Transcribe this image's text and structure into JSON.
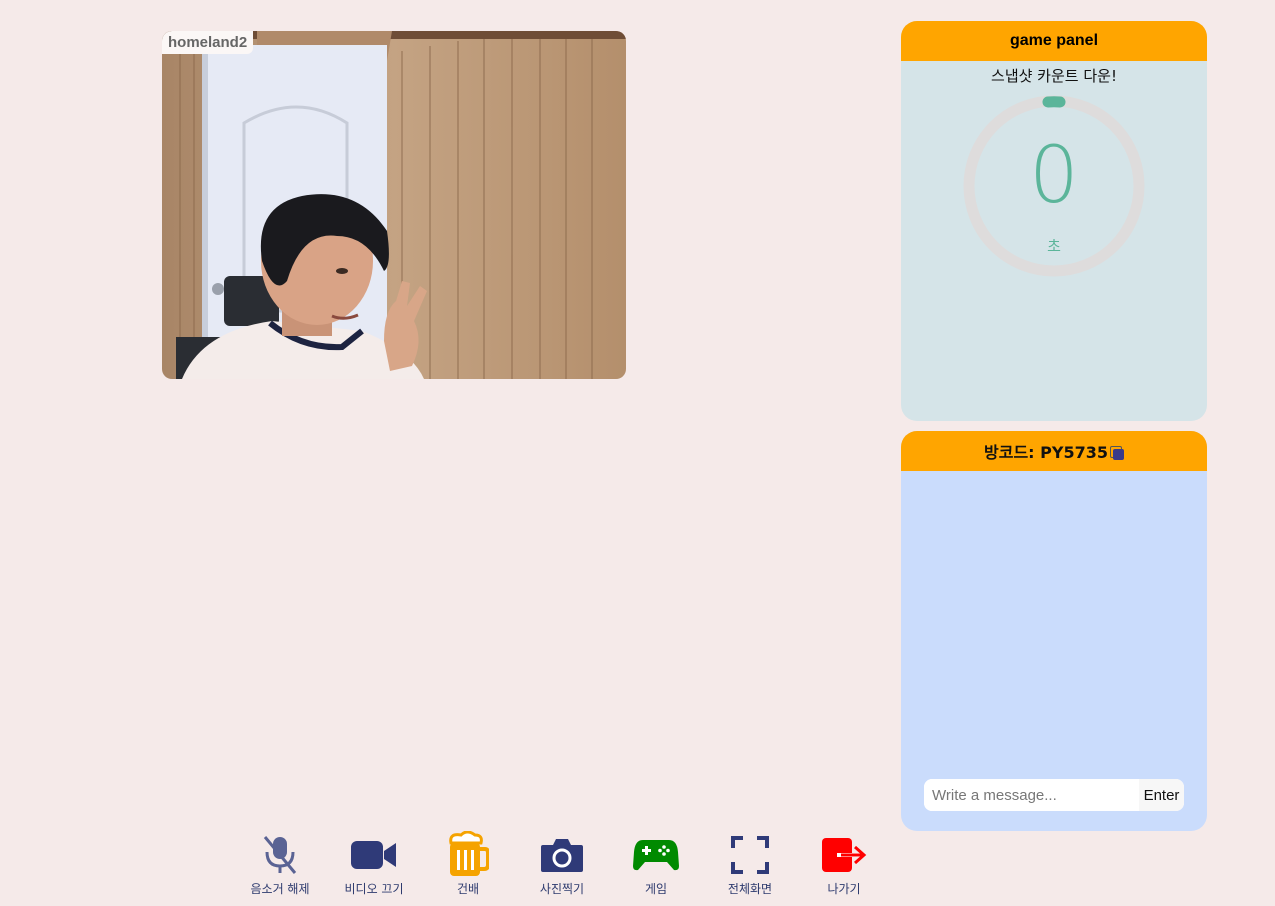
{
  "video": {
    "username": "homeland2"
  },
  "game_panel": {
    "title": "game panel",
    "countdown_title": "스냅샷 카운트 다운!",
    "timer_value": "0",
    "timer_unit": "초",
    "accent_color": "#5bb59a",
    "header_color": "#ffa500"
  },
  "chat": {
    "room_code_label": "방코드: PY5735",
    "input_placeholder": "Write a message...",
    "enter_label": "Enter"
  },
  "toolbar": {
    "items": [
      {
        "label": "음소거 해제",
        "icon": "mic-off-icon"
      },
      {
        "label": "비디오 끄기",
        "icon": "video-camera-icon"
      },
      {
        "label": "건배",
        "icon": "beer-mug-icon"
      },
      {
        "label": "사진찍기",
        "icon": "camera-icon"
      },
      {
        "label": "게임",
        "icon": "gamepad-icon"
      },
      {
        "label": "전체화면",
        "icon": "fullscreen-icon"
      },
      {
        "label": "나가기",
        "icon": "exit-icon"
      }
    ]
  }
}
